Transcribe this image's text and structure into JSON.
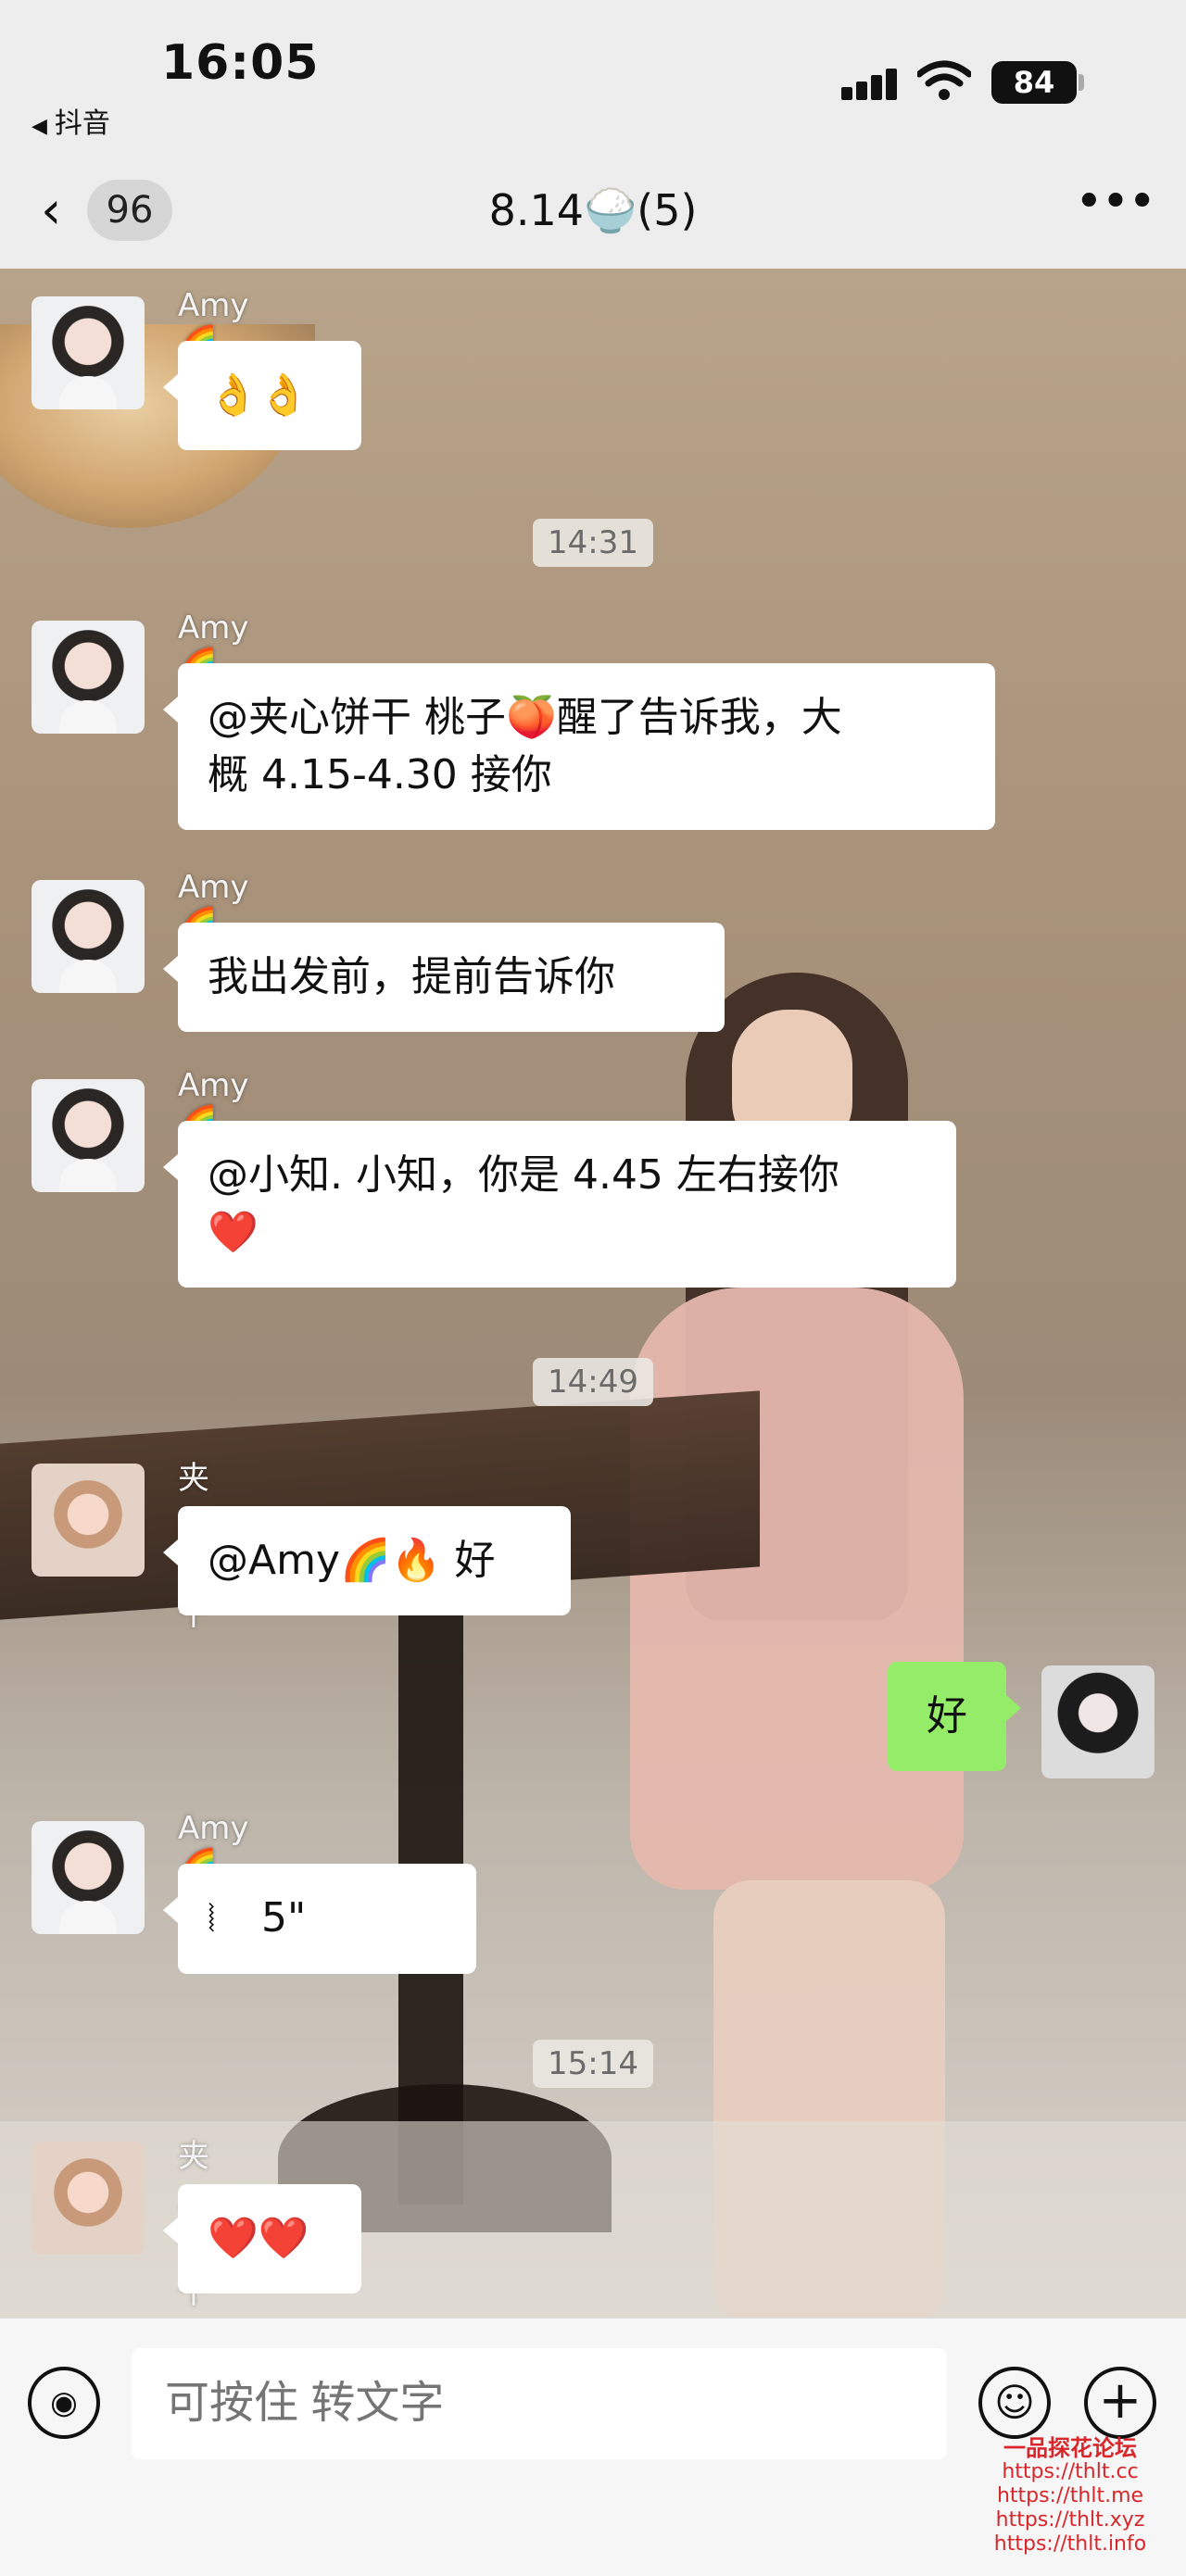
{
  "status_bar": {
    "time": "16:05",
    "back_app_label": "抖音",
    "battery_level": "84"
  },
  "chat_header": {
    "unread_count": "96",
    "title": "8.14🍚(5)",
    "back_icon": "chevron-left-icon",
    "more_icon": "more-dots-icon"
  },
  "messages": [
    {
      "sender": "Amy🌈🔥",
      "text": "👌👌"
    },
    {
      "timestamp": "14:31"
    },
    {
      "sender": "Amy🌈🔥",
      "line1": "@夹心饼干 桃子🍑醒了告诉我，大",
      "line2": "概 4.15-4.30 接你"
    },
    {
      "sender": "Amy🌈🔥",
      "text": "我出发前，提前告诉你"
    },
    {
      "sender": "Amy🌈🔥",
      "line1": "@小知. 小知，你是 4.45 左右接你",
      "line2": "❤️"
    },
    {
      "timestamp": "14:49"
    },
    {
      "sender": "夹心饼干",
      "text": "@Amy🌈🔥 好"
    },
    {
      "self": true,
      "text": "好"
    },
    {
      "sender": "Amy🌈🔥",
      "voice_duration": "5\""
    },
    {
      "timestamp": "15:14"
    },
    {
      "sender": "夹心饼干",
      "text": "❤️❤️"
    }
  ],
  "input_bar": {
    "placeholder": "可按住 转文字",
    "voice_icon": "voice-wave-icon",
    "emoji_icon": "smiley-icon",
    "plus_icon": "plus-icon"
  },
  "watermark": {
    "title": "一品探花论坛",
    "lines": [
      "https://thlt.cc",
      "https://thlt.me",
      "https://thlt.xyz",
      "https://thlt.info"
    ]
  }
}
